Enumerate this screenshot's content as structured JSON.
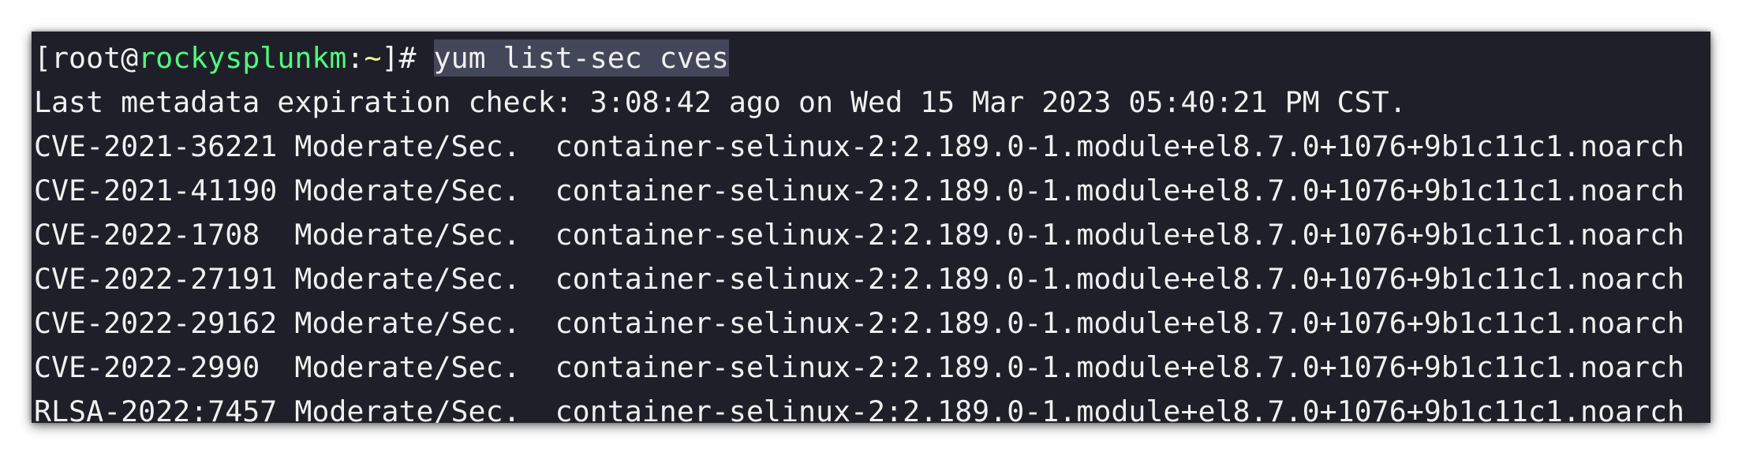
{
  "prompt": {
    "open_bracket": "[",
    "user": "root",
    "at": "@",
    "host": "rockysplunkm",
    "colon": ":",
    "cwd": "~",
    "close": "]# ",
    "command": "yum list-sec cves"
  },
  "metadata_line": "Last metadata expiration check: 3:08:42 ago on Wed 15 Mar 2023 05:40:21 PM CST.",
  "rows": [
    "CVE-2021-36221 Moderate/Sec.  container-selinux-2:2.189.0-1.module+el8.7.0+1076+9b1c11c1.noarch",
    "CVE-2021-41190 Moderate/Sec.  container-selinux-2:2.189.0-1.module+el8.7.0+1076+9b1c11c1.noarch",
    "CVE-2022-1708  Moderate/Sec.  container-selinux-2:2.189.0-1.module+el8.7.0+1076+9b1c11c1.noarch",
    "CVE-2022-27191 Moderate/Sec.  container-selinux-2:2.189.0-1.module+el8.7.0+1076+9b1c11c1.noarch",
    "CVE-2022-29162 Moderate/Sec.  container-selinux-2:2.189.0-1.module+el8.7.0+1076+9b1c11c1.noarch",
    "CVE-2022-2990  Moderate/Sec.  container-selinux-2:2.189.0-1.module+el8.7.0+1076+9b1c11c1.noarch",
    "RLSA-2022:7457 Moderate/Sec.  container-selinux-2:2.189.0-1.module+el8.7.0+1076+9b1c11c1.noarch"
  ],
  "colors": {
    "background": "#1e1f29",
    "text": "#f0f0f0",
    "user": "#50fa7b",
    "cwd": "#f1fa8c",
    "selection": "#44475a"
  }
}
